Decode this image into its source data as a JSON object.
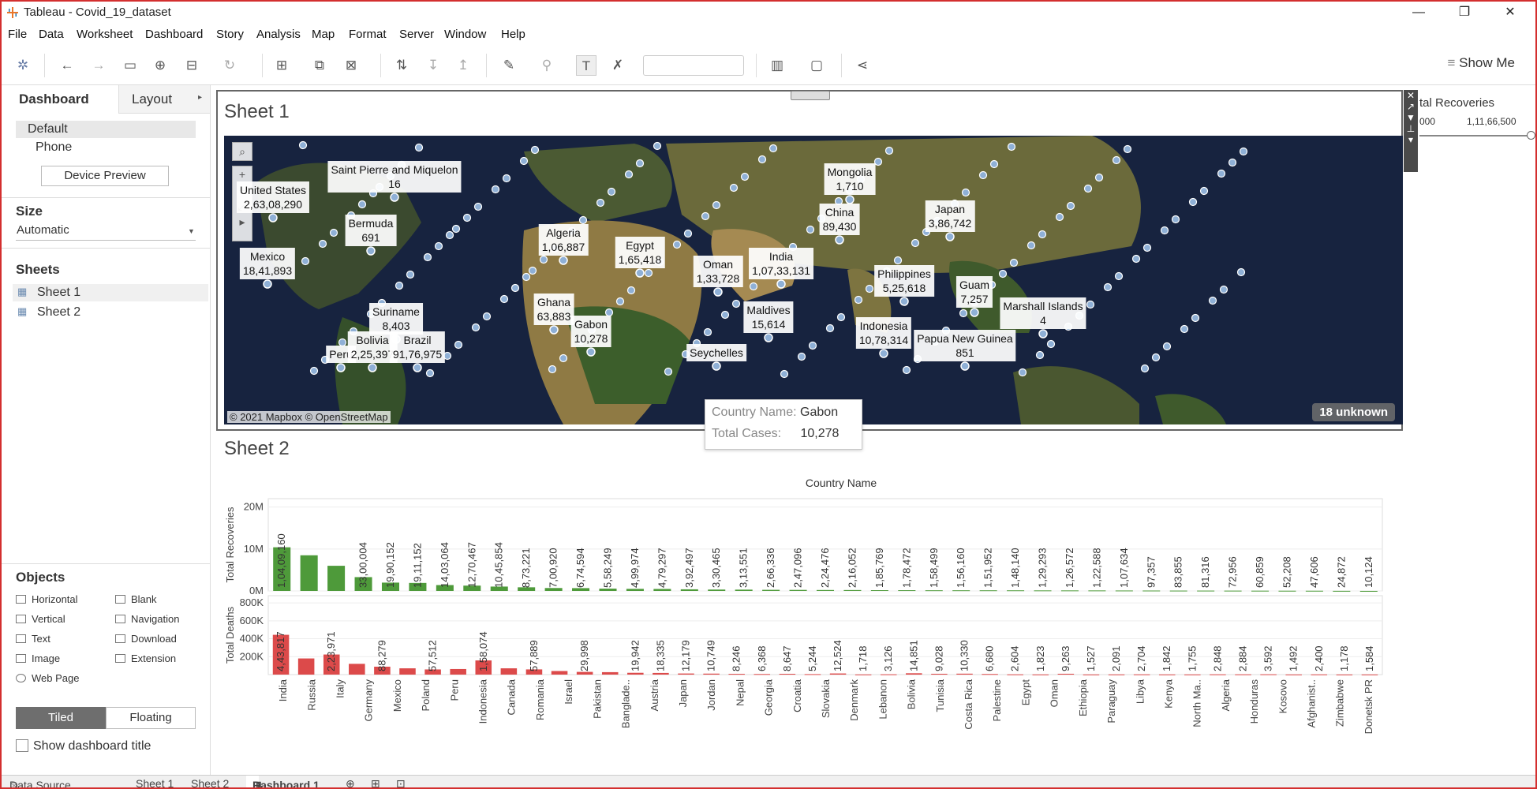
{
  "window": {
    "title": "Tableau - Covid_19_dataset",
    "controls": [
      "—",
      "❐",
      "✕"
    ]
  },
  "menu": [
    "File",
    "Data",
    "Worksheet",
    "Dashboard",
    "Story",
    "Analysis",
    "Map",
    "Format",
    "Server",
    "Window",
    "Help"
  ],
  "toolbar": {
    "show_me": "Show Me"
  },
  "left_pane": {
    "tabs": [
      "Dashboard",
      "Layout"
    ],
    "device": {
      "default": "Default",
      "phone": "Phone",
      "preview_button": "Device Preview"
    },
    "size": {
      "title": "Size",
      "value": "Automatic"
    },
    "sheets": {
      "title": "Sheets",
      "items": [
        "Sheet 1",
        "Sheet 2"
      ]
    },
    "objects": {
      "title": "Objects",
      "items": [
        "Horizontal",
        "Blank",
        "Vertical",
        "Navigation",
        "Text",
        "Download",
        "Image",
        "Extension",
        "Web Page"
      ]
    },
    "layout_mode": [
      "Tiled",
      "Floating"
    ],
    "show_title": "Show dashboard title"
  },
  "sheet1": {
    "title": "Sheet 1",
    "attribution": "© 2021 Mapbox © OpenStreetMap",
    "unknown_badge": "18 unknown",
    "labels": [
      {
        "name": "United States",
        "value": "2,63,08,290"
      },
      {
        "name": "Saint Pierre and Miquelon",
        "value": "16"
      },
      {
        "name": "Bermuda",
        "value": "691"
      },
      {
        "name": "Mexico",
        "value": "18,41,893"
      },
      {
        "name": "Suriname",
        "value": "8,403"
      },
      {
        "name": "Peru",
        "value": ""
      },
      {
        "name": "Bolivia",
        "value": "2,25,397"
      },
      {
        "name": "Brazil",
        "value": "91,76,975"
      },
      {
        "name": "Algeria",
        "value": "1,06,887"
      },
      {
        "name": "Egypt",
        "value": "1,65,418"
      },
      {
        "name": "Ghana",
        "value": "63,883"
      },
      {
        "name": "Gabon",
        "value": "10,278"
      },
      {
        "name": "Oman",
        "value": "1,33,728"
      },
      {
        "name": "Seychelles",
        "value": ""
      },
      {
        "name": "Mongolia",
        "value": "1,710"
      },
      {
        "name": "China",
        "value": "89,430"
      },
      {
        "name": "India",
        "value": "1,07,33,131"
      },
      {
        "name": "Maldives",
        "value": "15,614"
      },
      {
        "name": "Japan",
        "value": "3,86,742"
      },
      {
        "name": "Philippines",
        "value": "5,25,618"
      },
      {
        "name": "Guam",
        "value": "7,257"
      },
      {
        "name": "Marshall Islands",
        "value": "4"
      },
      {
        "name": "Indonesia",
        "value": "10,78,314"
      },
      {
        "name": "Papua New Guinea",
        "value": "851"
      }
    ]
  },
  "tooltip": {
    "country_key": "Country Name:",
    "country_value": "Gabon",
    "cases_key": "Total Cases:",
    "cases_value": "10,278"
  },
  "legend": {
    "title": "tal Recoveries",
    "min": "000",
    "max": "1,11,66,500"
  },
  "sheet2": {
    "title": "Sheet 2",
    "header": "Country Name",
    "bottom_tabs": [
      "Data Source",
      "Sheet 1",
      "Sheet 2",
      "Dashboard 1"
    ]
  },
  "chart_data": {
    "type": "bar",
    "xlabel": "Country Name",
    "categories": [
      "India",
      "Russia",
      "Italy",
      "Germany",
      "Mexico",
      "Poland",
      "Peru",
      "Indonesia",
      "Canada",
      "Romania",
      "Israel",
      "Pakistan",
      "Banglade..",
      "Austria",
      "Japan",
      "Jordan",
      "Nepal",
      "Georgia",
      "Croatia",
      "Slovakia",
      "Denmark",
      "Lebanon",
      "Bolivia",
      "Tunisia",
      "Costa Rica",
      "Palestine",
      "Egypt",
      "Oman",
      "Ethiopia",
      "Paraguay",
      "Libya",
      "Kenya",
      "North Ma..",
      "Algeria",
      "Honduras",
      "Kosovo",
      "Afghanist..",
      "Zimbabwe",
      "Donetsk PR"
    ],
    "series": [
      {
        "name": "Total Recoveries",
        "ylabel": "Total Recoveries",
        "ylim": [
          0,
          22000000
        ],
        "ticks": [
          "0M",
          "10M",
          "20M"
        ],
        "color": "#4e9a3a",
        "values": [
          10409160,
          8500000,
          6000000,
          3300004,
          1990152,
          1911152,
          1403064,
          1270467,
          1045854,
          873221,
          700920,
          674594,
          558249,
          499974,
          479297,
          392497,
          330465,
          313551,
          266336,
          247096,
          224476,
          216052,
          185769,
          178472,
          158499,
          156160,
          151952,
          148140,
          129293,
          126572,
          122588,
          107634,
          97357,
          83855,
          81316,
          72956,
          60859,
          52208,
          47606,
          24872,
          10124
        ],
        "labels": [
          "1,04,09,160",
          "",
          "",
          "33,00,004",
          "19,90,152",
          "19,11,152",
          "14,03,064",
          "12,70,467",
          "10,45,854",
          "8,73,221",
          "7,00,920",
          "6,74,594",
          "5,58,249",
          "4,99,974",
          "4,79,297",
          "3,92,497",
          "3,30,465",
          "3,13,551",
          "2,66,336",
          "2,47,096",
          "2,24,476",
          "2,16,052",
          "1,85,769",
          "1,78,472",
          "1,58,499",
          "1,56,160",
          "1,51,952",
          "1,48,140",
          "1,29,293",
          "1,26,572",
          "1,22,588",
          "1,07,634",
          "97,357",
          "83,855",
          "81,316",
          "72,956",
          "60,859",
          "52,208",
          "47,606",
          "24,872",
          "10,124"
        ]
      },
      {
        "name": "Total Deaths",
        "ylabel": "Total Deaths",
        "ylim": [
          0,
          880000
        ],
        "ticks": [
          "200K",
          "400K",
          "600K",
          "800K"
        ],
        "color": "#dc4a4a",
        "values": [
          443817,
          180000,
          223971,
          120000,
          88279,
          70000,
          57512,
          62000,
          158074,
          70000,
          57889,
          40000,
          29998,
          27000,
          19942,
          18335,
          12179,
          10749,
          8246,
          6368,
          8647,
          5244,
          12524,
          1718,
          3126,
          14851,
          9028,
          10330,
          6680,
          2604,
          1823,
          9263,
          1527,
          2091,
          2704,
          1842,
          1755,
          2848,
          2884,
          3592,
          1492,
          2400,
          1178,
          1584
        ],
        "labels": [
          "4,43,817",
          "",
          "2,23,971",
          "",
          "88,279",
          "",
          "57,512",
          "",
          "1,58,074",
          "",
          "57,889",
          "",
          "29,998",
          "",
          "19,942",
          "18,335",
          "12,179",
          "10,749",
          "8,246",
          "6,368",
          "8,647",
          "5,244",
          "12,524",
          "1,718",
          "3,126",
          "14,851",
          "9,028",
          "10,330",
          "6,680",
          "2,604",
          "1,823",
          "9,263",
          "1,527",
          "2,091",
          "2,704",
          "1,842",
          "1,755",
          "2,848",
          "2,884",
          "3,592",
          "1,492",
          "2,400",
          "1,178",
          "1,584"
        ]
      }
    ]
  }
}
